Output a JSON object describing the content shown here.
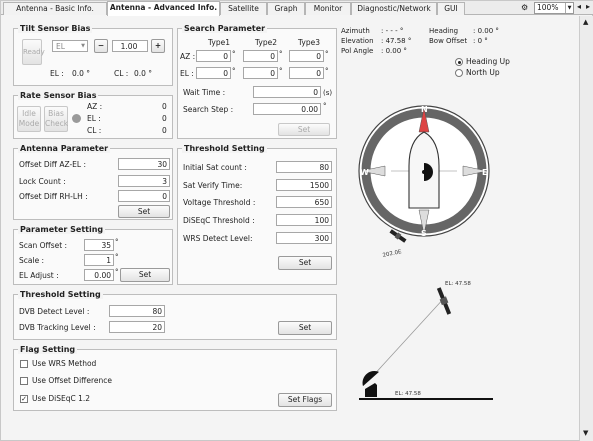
{
  "tabs": [
    {
      "label": "Antenna - Basic Info."
    },
    {
      "label": "Antenna - Advanced Info."
    },
    {
      "label": "Satellite"
    },
    {
      "label": "Graph"
    },
    {
      "label": "Monitor"
    },
    {
      "label": "Diagnostic/Network"
    },
    {
      "label": "GUI"
    }
  ],
  "zoom": "100%",
  "tilt": {
    "title": "Tilt Sensor Bias",
    "ready": "Ready",
    "axis": "EL",
    "minus": "−",
    "value": "1.00",
    "plus": "+",
    "el_label": "EL :",
    "el_value": "0.0 °",
    "cl_label": "CL :",
    "cl_value": "0.0 °"
  },
  "rate": {
    "title": "Rate Sensor Bias",
    "idle": "Idle Mode",
    "bias": "Bias Check",
    "az_label": "AZ :",
    "az_value": "0",
    "el_label": "EL :",
    "el_value": "0",
    "cl_label": "CL :",
    "cl_value": "0"
  },
  "search": {
    "title": "Search Parameter",
    "type1": "Type1",
    "type2": "Type2",
    "type3": "Type3",
    "az_label": "AZ :",
    "el_label": "EL :",
    "az": [
      "0",
      "0",
      "0"
    ],
    "el": [
      "0",
      "0",
      "0"
    ],
    "deg": "°",
    "wait_label": "Wait Time :",
    "wait_value": "0",
    "wait_unit": "(s)",
    "step_label": "Search Step :",
    "step_value": "0.00",
    "step_unit": "°",
    "set": "Set"
  },
  "antenna": {
    "title": "Antenna Parameter",
    "offset_label": "Offset Diff AZ-EL :",
    "offset_value": "30",
    "lock_label": "Lock Count :",
    "lock_value": "3",
    "rhlh_label": "Offset Diff RH-LH :",
    "rhlh_value": "0",
    "set": "Set"
  },
  "param": {
    "title": "Parameter Setting",
    "scan_label": "Scan Offset :",
    "scan_value": "35",
    "scale_label": "Scale :",
    "scale_value": "1",
    "eladj_label": "EL Adjust :",
    "eladj_value": "0.00",
    "deg": "°",
    "set": "Set"
  },
  "thresh1": {
    "title": "Threshold Setting",
    "init_label": "Initial Sat count :",
    "init_value": "80",
    "verify_label": "Sat Verify Time:",
    "verify_value": "1500",
    "volt_label": "Voltage Threshold :",
    "volt_value": "650",
    "diseqc_label": "DiSEqC Threshold :",
    "diseqc_value": "100",
    "wrs_label": "WRS Detect Level:",
    "wrs_value": "300",
    "set": "Set"
  },
  "thresh2": {
    "title": "Threshold Setting",
    "dvb_detect_label": "DVB Detect Level :",
    "dvb_detect_value": "80",
    "dvb_track_label": "DVB Tracking Level :",
    "dvb_track_value": "20",
    "set": "Set"
  },
  "flag": {
    "title": "Flag Setting",
    "wrs": "Use WRS Method",
    "wrs_checked": false,
    "offset": "Use Offset Difference",
    "offset_checked": false,
    "diseqc": "Use DiSEqC 1.2",
    "diseqc_checked": true,
    "set": "Set Flags"
  },
  "status": {
    "azimuth_label": "Azimuth",
    "azimuth_value": ": - - - °",
    "elevation_label": "Elevation",
    "elevation_value": ": 47.58 °",
    "pol_label": "Pol Angle",
    "pol_value": ": 0.00 °",
    "heading_label": "Heading",
    "heading_value": ": 0.00 °",
    "bow_label": "Bow Offset",
    "bow_value": ": 0 °"
  },
  "view": {
    "heading_up": "Heading Up",
    "north_up": "North Up",
    "selected": "heading_up"
  },
  "compass": {
    "n": "N",
    "e": "E",
    "s": "S",
    "w": "W",
    "sat_label": "202.0E"
  },
  "elevation_view": {
    "top_label": "EL: 47.58",
    "bottom_label": "EL: 47.58"
  }
}
